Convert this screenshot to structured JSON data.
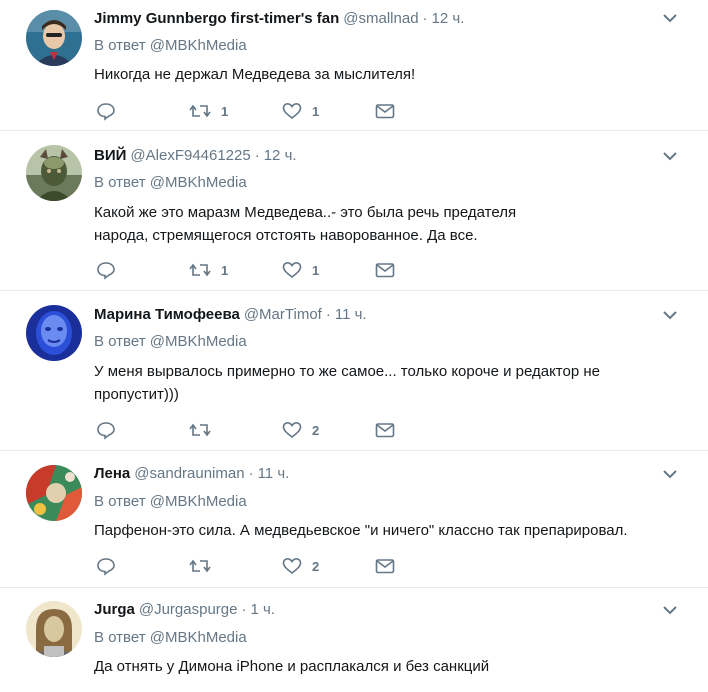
{
  "tweets": [
    {
      "name": "Jimmy Gunnbergo first-timer's fan",
      "handle": "@smallnad",
      "time": "12 ч.",
      "reply_prefix": "В ответ",
      "reply_to": "@MBKhMedia",
      "text": "Никогда не держал Медведева за мыслителя!",
      "retweets": "1",
      "likes": "1",
      "avatar_colors": [
        "#2f6f8f",
        "#e8c8a8",
        "#3a2a20"
      ]
    },
    {
      "name": "ВИЙ",
      "handle": "@AlexF94461225",
      "time": "12 ч.",
      "reply_prefix": "В ответ",
      "reply_to": "@MBKhMedia",
      "text": "Какой же это маразм Медведева..- это была речь предателя народа, стремящегося отстоять наворованное. Да все.",
      "retweets": "1",
      "likes": "1",
      "avatar_colors": [
        "#8a9a6a",
        "#4d5a3a",
        "#c8b890"
      ]
    },
    {
      "name": "Марина Тимофеева",
      "handle": "@MarTimof",
      "time": "11 ч.",
      "reply_prefix": "В ответ",
      "reply_to": "@MBKhMedia",
      "text": "У меня вырвалось примерно то же самое... только короче и редактор не пропустит)))",
      "retweets": "",
      "likes": "2",
      "avatar_colors": [
        "#2b4fd8",
        "#6a8cf0",
        "#1a2f9a"
      ]
    },
    {
      "name": "Лена",
      "handle": "@sandrauniman",
      "time": "11 ч.",
      "reply_prefix": "В ответ",
      "reply_to": "@MBKhMedia",
      "text": "Парфенон-это сила. А  медведьевское \"и ничего\" классно так препарировал.",
      "retweets": "",
      "likes": "2",
      "avatar_colors": [
        "#c83a2a",
        "#3a8a5a",
        "#e0d0b0"
      ]
    },
    {
      "name": "Jurga",
      "handle": "@Jurgaspurge",
      "time": "1 ч.",
      "reply_prefix": "В ответ",
      "reply_to": "@MBKhMedia",
      "text": "Да отнять у Димона iPhone и расплакался и без санкций",
      "retweets": "",
      "likes": "",
      "avatar_colors": [
        "#d8c8a0",
        "#8a6a40",
        "#f0e6cc"
      ]
    }
  ],
  "icons": {
    "reply": "reply-icon",
    "retweet": "retweet-icon",
    "like": "heart-icon",
    "dm": "envelope-icon",
    "menu": "chevron-down-icon"
  }
}
